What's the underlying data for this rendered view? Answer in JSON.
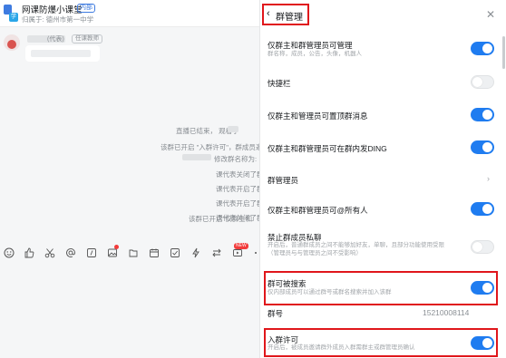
{
  "chat": {
    "group_name": "网课防爆小课堂",
    "group_badge": "内部",
    "group_subtitle": "归属于: 德州市第一中学",
    "message": {
      "sender_tag": "(代表)",
      "sender_role": "任课教师"
    },
    "system_messages": [
      "直播已结束，   观看了",
      "该群已开启 \"入群许可\"，群成员邀请",
      "修改群名称为:",
      "课代表关闭了群",
      "课代表开启了群",
      "课代表开启了群",
      "课代表关闭了群",
      "该群已开启\"仅群主和"
    ],
    "toolbar_icons": [
      "emoji-icon",
      "thumbs-up-icon",
      "scissors-icon",
      "at-icon",
      "quote-icon",
      "image-icon",
      "file-icon",
      "calendar-icon",
      "check-icon",
      "lightning-icon",
      "transfer-icon",
      "video-icon",
      "more-icon"
    ],
    "new_badge": "NEW"
  },
  "panel": {
    "title": "群管理",
    "back_icon": "chevron-left-icon",
    "close_icon": "close-icon",
    "rows": [
      {
        "label": "仅群主和群管理员可管理",
        "desc": "群名称，成员，公告，头像，机器人",
        "control": "toggle",
        "on": true
      },
      {
        "label": "快捷栏",
        "control": "toggle",
        "on": false
      },
      {
        "label": "仅群主和管理员可置顶群消息",
        "control": "toggle",
        "on": true
      },
      {
        "label": "仅群主和群管理员可在群内发DING",
        "control": "toggle",
        "on": true
      },
      {
        "label": "群管理员",
        "control": "chevron"
      },
      {
        "label": "仅群主和群管理员可@所有人",
        "control": "toggle",
        "on": true
      },
      {
        "label": "禁止群成员私聊",
        "desc": "开启后，普通群成员之间不能够加好友，单聊，且部分功能使用受限",
        "desc2": "（管理员与与管理员之间不受影响）",
        "control": "toggle",
        "on": false
      },
      {
        "label": "群可被搜索",
        "desc": "仅内部成员可以通过群号或群名搜索并加入该群",
        "control": "toggle",
        "on": true
      },
      {
        "label": "群号",
        "value": "15210008114",
        "control": "value"
      },
      {
        "label": "入群许可",
        "desc": "开启后，被成员邀请群外成员入群需群主或群管理员确认",
        "control": "toggle",
        "on": true
      }
    ]
  },
  "colors": {
    "accent": "#1f7cf0",
    "highlight": "#e0161b"
  }
}
